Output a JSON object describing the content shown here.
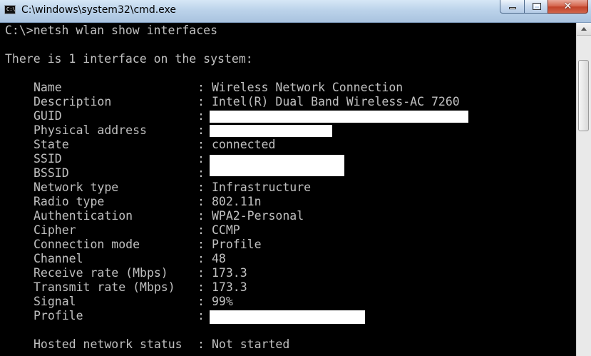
{
  "window": {
    "title": "C:\\windows\\system32\\cmd.exe",
    "icon_label": "C:\\",
    "min_icon": "minimize-icon",
    "max_icon": "maximize-icon",
    "close_icon": "close-icon",
    "close_glyph": "✕",
    "accent_close": "#c2432a",
    "console_bg": "#000000",
    "console_fg": "#c0c0c0"
  },
  "console": {
    "command": "C:\\>netsh wlan show interfaces",
    "header": "There is 1 interface on the system:",
    "fields": [
      {
        "key": "Name",
        "value": "Wireless Network Connection"
      },
      {
        "key": "Description",
        "value": "Intel(R) Dual Band Wireless-AC 7260"
      },
      {
        "key": "GUID",
        "value": "",
        "redacted": true
      },
      {
        "key": "Physical address",
        "value": "",
        "redacted": true
      },
      {
        "key": "State",
        "value": "connected"
      },
      {
        "key": "SSID",
        "value": "",
        "redacted": true
      },
      {
        "key": "BSSID",
        "value": "",
        "redacted": true
      },
      {
        "key": "Network type",
        "value": "Infrastructure"
      },
      {
        "key": "Radio type",
        "value": "802.11n"
      },
      {
        "key": "Authentication",
        "value": "WPA2-Personal"
      },
      {
        "key": "Cipher",
        "value": "CCMP"
      },
      {
        "key": "Connection mode",
        "value": "Profile"
      },
      {
        "key": "Channel",
        "value": "48"
      },
      {
        "key": "Receive rate (Mbps)",
        "value": "173.3"
      },
      {
        "key": "Transmit rate (Mbps)",
        "value": "173.3"
      },
      {
        "key": "Signal",
        "value": "99%"
      },
      {
        "key": "Profile",
        "value": "",
        "redacted": true
      }
    ],
    "hosted": {
      "key": "Hosted network status",
      "value": "Not started"
    },
    "separator": ":"
  }
}
